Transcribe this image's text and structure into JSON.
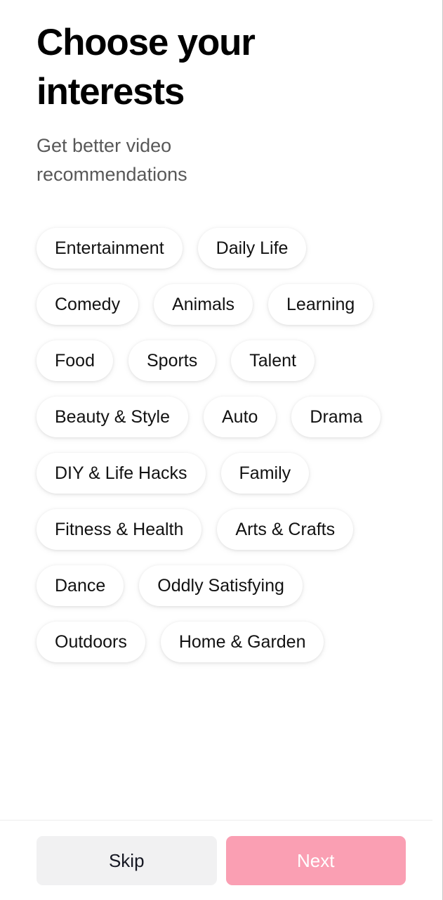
{
  "header": {
    "title": "Choose your interests",
    "subtitle": "Get better video recommendations"
  },
  "interests": {
    "chips": [
      {
        "label": "Entertainment",
        "selected": false
      },
      {
        "label": "Daily Life",
        "selected": false
      },
      {
        "label": "Comedy",
        "selected": false
      },
      {
        "label": "Animals",
        "selected": false
      },
      {
        "label": "Learning",
        "selected": false
      },
      {
        "label": "Food",
        "selected": false
      },
      {
        "label": "Sports",
        "selected": false
      },
      {
        "label": "Talent",
        "selected": false
      },
      {
        "label": "Beauty & Style",
        "selected": false
      },
      {
        "label": "Auto",
        "selected": false
      },
      {
        "label": "Drama",
        "selected": false
      },
      {
        "label": "DIY & Life Hacks",
        "selected": false
      },
      {
        "label": "Family",
        "selected": false
      },
      {
        "label": "Fitness & Health",
        "selected": false
      },
      {
        "label": "Arts & Crafts",
        "selected": false
      },
      {
        "label": "Dance",
        "selected": false
      },
      {
        "label": "Oddly Satisfying",
        "selected": false
      },
      {
        "label": "Outdoors",
        "selected": false
      },
      {
        "label": "Home & Garden",
        "selected": false
      }
    ]
  },
  "footer": {
    "skip_label": "Skip",
    "next_label": "Next"
  },
  "colors": {
    "page_background": "#ffffff",
    "title_text": "#000000",
    "subtitle_text": "#585858",
    "chip_background": "#ffffff",
    "chip_text": "#121212",
    "skip_background": "#f1f1f2",
    "skip_text": "#161823",
    "next_background": "#fa9fb3",
    "next_text": "#ffffff",
    "divider": "#ededed"
  }
}
